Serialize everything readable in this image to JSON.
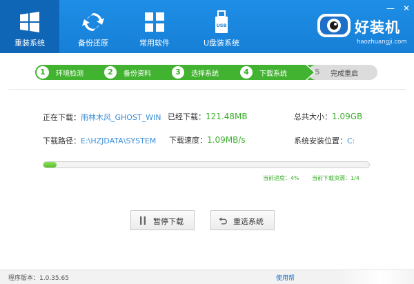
{
  "header": {
    "nav": [
      {
        "label": "重装系统",
        "icon": "windows-icon"
      },
      {
        "label": "备份还原",
        "icon": "refresh-icon"
      },
      {
        "label": "常用软件",
        "icon": "apps-grid-icon"
      },
      {
        "label": "U盘装系统",
        "icon": "usb-drive-icon"
      }
    ],
    "active_index": 0,
    "window_controls": {
      "minimize": "—",
      "close": "✕"
    },
    "brand": {
      "name": "好装机",
      "url": "haozhuangji.com"
    }
  },
  "steps": [
    {
      "num": "1",
      "label": "环境检测",
      "state": "done"
    },
    {
      "num": "2",
      "label": "备份资料",
      "state": "done"
    },
    {
      "num": "3",
      "label": "选择系统",
      "state": "done"
    },
    {
      "num": "4",
      "label": "下载系统",
      "state": "current"
    },
    {
      "num": "5",
      "label": "完成重启",
      "state": "pending"
    }
  ],
  "download": {
    "downloading_label": "正在下载：",
    "downloading_value": "雨林木风_GHOST_WIN",
    "downloaded_label": "已经下载：",
    "downloaded_value": "121.48MB",
    "total_label": "总共大小：",
    "total_value": "1.09GB",
    "path_label": "下载路径：",
    "path_value": "E:\\HZJDATA\\SYSTEM",
    "speed_label": "下载速度：",
    "speed_value": "1.09MB/s",
    "install_label": "系统安装位置：",
    "install_value": "C:"
  },
  "progress": {
    "percent": 4,
    "current_label": "当前进度：",
    "current_value": "4%",
    "resource_label": "当前下载资源：",
    "resource_value": "1/4"
  },
  "buttons": {
    "pause": {
      "label": "暂停下载",
      "icon": "pause-icon"
    },
    "reselect": {
      "label": "重选系统",
      "icon": "undo-arrow-icon"
    }
  },
  "footer": {
    "version": "程序版本：1.0.35.65",
    "help": "使用帮"
  },
  "colors": {
    "header_blue": "#1e8ee6",
    "active_nav": "#0f66b7",
    "accent_green": "#3aae2a",
    "link_blue": "#3b8fd9"
  }
}
